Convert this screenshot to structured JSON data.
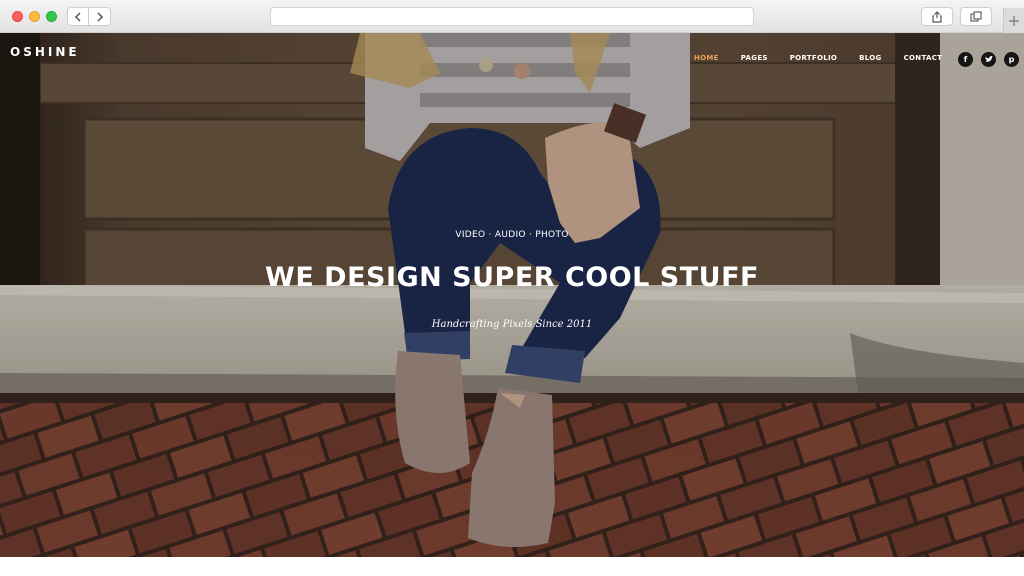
{
  "browser": {
    "address_text": "",
    "back_icon": "chevron-left-icon",
    "forward_icon": "chevron-right-icon",
    "share_icon": "share-icon",
    "tabs_icon": "tabs-icon",
    "new_tab_icon": "plus-icon"
  },
  "site": {
    "logo": "OSHINE",
    "nav": [
      {
        "label": "HOME",
        "active": true
      },
      {
        "label": "PAGES",
        "active": false
      },
      {
        "label": "PORTFOLIO",
        "active": false
      },
      {
        "label": "BLOG",
        "active": false
      },
      {
        "label": "CONTACT",
        "active": false
      }
    ],
    "social": [
      {
        "icon": "facebook-icon",
        "glyph": "f"
      },
      {
        "icon": "twitter-icon",
        "glyph": "t"
      },
      {
        "icon": "pinterest-icon",
        "glyph": "p"
      }
    ]
  },
  "hero": {
    "kicker": "VIDEO · AUDIO · PHOTO",
    "headline": "WE DESIGN SUPER COOL STUFF",
    "tagline": "Handcrafting Pixels Since 2011"
  },
  "colors": {
    "accent": "#e8a052",
    "door": "#6b5541",
    "brick": "#8a4535",
    "text": "#ffffff"
  }
}
